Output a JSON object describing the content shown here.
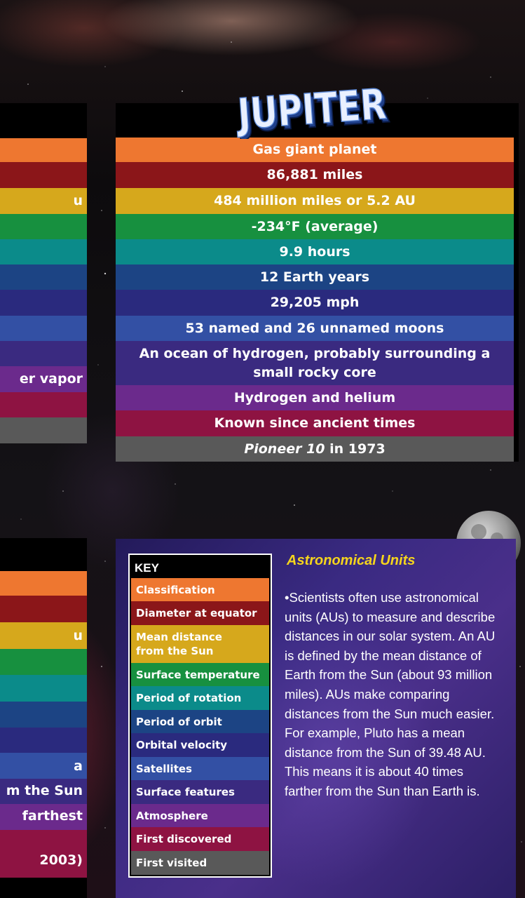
{
  "colors": {
    "classification": "#ee7730",
    "diameter": "#8b1619",
    "mean_distance": "#d6a81c",
    "surface_temperature": "#17903f",
    "period_of_rotation": "#0b8b8a",
    "period_of_orbit": "#1c4484",
    "orbital_velocity": "#2a2a7e",
    "satellites": "#3350a4",
    "surface_features": "#3a2a80",
    "atmosphere": "#6b2a8c",
    "first_discovered": "#8e1342",
    "first_visited": "#595959",
    "au_title": "#f6d51c"
  },
  "left_top_panel": {
    "rows": [
      "",
      "",
      "u",
      "",
      "",
      "",
      "",
      "",
      "",
      "er vapor",
      "",
      ""
    ]
  },
  "left_bottom_panel": {
    "rows": [
      "",
      "",
      "u",
      "",
      "",
      "",
      "",
      "a",
      "m the Sun",
      " farthest",
      "",
      "2003)"
    ]
  },
  "jupiter": {
    "title": "JUPITER",
    "classification": "Gas giant planet",
    "diameter": "86,881 miles",
    "mean_distance": "484 million miles or 5.2 AU",
    "surface_temperature": "-234°F (average)",
    "period_of_rotation": "9.9 hours",
    "period_of_orbit": "12 Earth years",
    "orbital_velocity": "29,205 mph",
    "satellites": "53 named and 26 unnamed moons",
    "surface_features": "An ocean of hydrogen, probably surrounding a small rocky core",
    "atmosphere": "Hydrogen and helium",
    "first_discovered": "Known since ancient times",
    "first_visited_craft": "Pioneer 10",
    "first_visited_rest": " in 1973"
  },
  "key": {
    "title": "KEY",
    "items": [
      "Classification",
      "Diameter at equator",
      "Mean distance from the Sun",
      "Surface temperature",
      "Period of rotation",
      "Period of orbit",
      "Orbital velocity",
      "Satellites",
      "Surface features",
      "Atmosphere",
      "First discovered",
      "First visited"
    ]
  },
  "astronomical_units": {
    "title": "Astronomical Units",
    "body": "•Scientists often use astronomical units (AUs) to measure and describe distances in our solar system. An AU is defined by the mean distance of Earth from the Sun (about 93 million miles). AUs make comparing distances from the Sun much easier. For example, Pluto has a mean distance from the Sun of 39.48 AU. This means it is about 40 times farther from the Sun than Earth is."
  }
}
